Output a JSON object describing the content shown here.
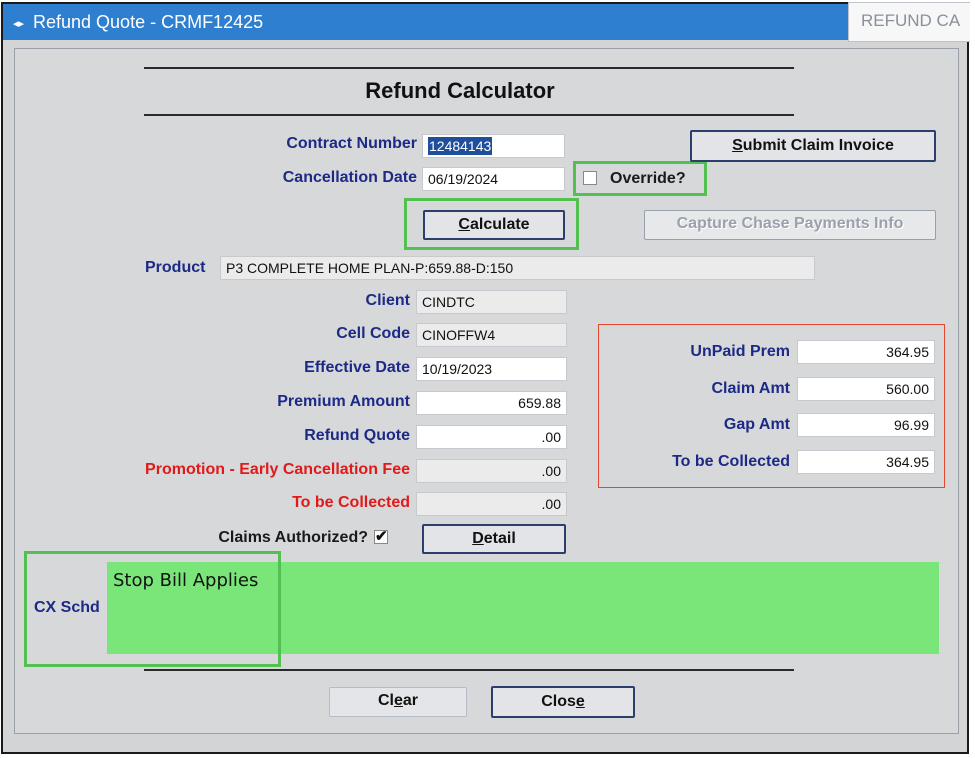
{
  "window": {
    "title": "Refund Quote - CRMF12425",
    "title_icon": "app-arrows-icon",
    "tab_fragment": "REFUND CA"
  },
  "form": {
    "heading": "Refund Calculator",
    "contract_number_label": "Contract Number",
    "contract_number_value": "12484143",
    "cancellation_date_label": "Cancellation Date",
    "cancellation_date_value": "06/19/2024",
    "override_label": "Override?",
    "override_checked": false,
    "product_label": "Product",
    "product_value": "P3 COMPLETE HOME PLAN-P:659.88-D:150",
    "client_label": "Client",
    "client_value": "CINDTC",
    "cell_code_label": "Cell Code",
    "cell_code_value": "CINOFFW4",
    "effective_date_label": "Effective Date",
    "effective_date_value": "10/19/2023",
    "premium_amount_label": "Premium Amount",
    "premium_amount_value": "659.88",
    "refund_quote_label": "Refund Quote",
    "refund_quote_value": ".00",
    "promotion_fee_label": "Promotion - Early Cancellation Fee",
    "promotion_fee_value": ".00",
    "to_be_collected_label": "To be Collected",
    "to_be_collected_value": ".00",
    "claims_authorized_label": "Claims Authorized?",
    "claims_authorized_checked": true,
    "cx_schd_label": "CX Schd",
    "cx_schd_value": "Stop Bill Applies"
  },
  "claim_panel": {
    "unpaid_prem_label": "UnPaid Prem",
    "unpaid_prem_value": "364.95",
    "claim_amt_label": "Claim Amt",
    "claim_amt_value": "560.00",
    "gap_amt_label": "Gap Amt",
    "gap_amt_value": "96.99",
    "to_be_collected_label": "To be Collected",
    "to_be_collected_value": "364.95"
  },
  "buttons": {
    "submit_claim_invoice_pre": "",
    "submit_claim_invoice_key": "S",
    "submit_claim_invoice_post": "ubmit Claim Invoice",
    "calculate_key": "C",
    "calculate_post": "alculate",
    "capture_chase": "Capture Chase Payments Info",
    "detail_key": "D",
    "detail_post": "etail",
    "clear_pre": "Cl",
    "clear_key": "e",
    "clear_post": "ar",
    "close_pre": "Clos",
    "close_key": "e",
    "close_post": ""
  },
  "colors": {
    "title_bar": "#2f7fd0",
    "label_blue": "#1c2a86",
    "label_red": "#e01a1a",
    "highlight_green": "#52c152",
    "cx_area_green": "#7ae67a",
    "panel_red_border": "#e0482f"
  }
}
